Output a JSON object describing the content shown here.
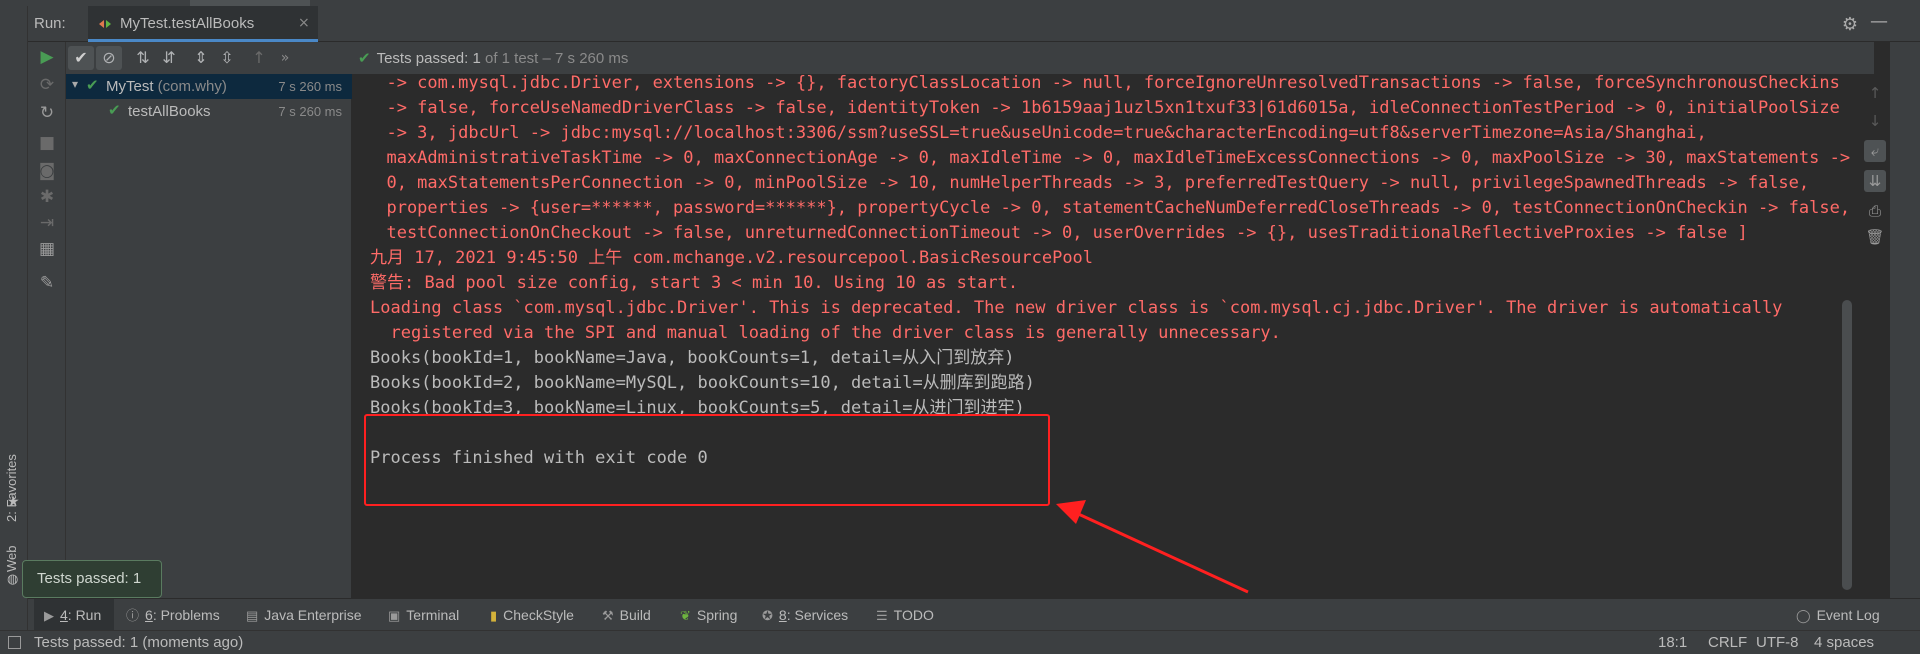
{
  "editor_tab_fragment": "MyTest",
  "run_header": {
    "label": "Run:",
    "tab_title": "MyTest.testAllBooks",
    "tab_close": "×"
  },
  "test_toolbar": {
    "status_prefix": "Tests passed: ",
    "status_count": "1",
    "status_suffix": " of 1 test – 7 s 260 ms",
    "more": "»"
  },
  "test_tree": [
    {
      "name": "MyTest",
      "pkg": " (com.why)",
      "time": "7 s 260 ms"
    },
    {
      "name": "testAllBooks",
      "pkg": "",
      "time": "7 s 260 ms"
    }
  ],
  "console": {
    "lines": [
      {
        "text": "  -> com.mysql.jdbc.Driver, extensions -> {}, factoryClassLocation -> null, forceIgnoreUnresolvedTransactions -> false, forceSynchronousCheckins",
        "style": "red"
      },
      {
        "text": "  -> false, forceUseNamedDriverClass -> false, identityToken -> 1b6159aaj1uzl5xn1txuf33|61d6015a, idleConnectionTestPeriod -> 0, initialPoolSize",
        "style": "red"
      },
      {
        "text": "  -> 3, jdbcUrl -> jdbc:mysql://localhost:3306/ssm?useSSL=true&useUnicode=true&characterEncoding=utf8&serverTimezone=Asia/Shanghai,",
        "style": "red"
      },
      {
        "text": "  maxAdministrativeTaskTime -> 0, maxConnectionAge -> 0, maxIdleTime -> 0, maxIdleTimeExcessConnections -> 0, maxPoolSize -> 30, maxStatements ->",
        "style": "red"
      },
      {
        "text": "  0, maxStatementsPerConnection -> 0, minPoolSize -> 10, numHelperThreads -> 3, preferredTestQuery -> null, privilegeSpawnedThreads -> false,",
        "style": "red"
      },
      {
        "text": "  properties -> {user=******, password=******}, propertyCycle -> 0, statementCacheNumDeferredCloseThreads -> 0, testConnectionOnCheckin -> false,",
        "style": "red"
      },
      {
        "text": "  testConnectionOnCheckout -> false, unreturnedConnectionTimeout -> 0, userOverrides -> {}, usesTraditionalReflectiveProxies -> false ]",
        "style": "red"
      },
      {
        "text": "九月 17, 2021 9:45:50 上午 com.mchange.v2.resourcepool.BasicResourcePool",
        "style": "red"
      },
      {
        "text": "警告: Bad pool size config, start 3 < min 10. Using 10 as start.",
        "style": "red"
      },
      {
        "text": "Loading class `com.mysql.jdbc.Driver'. This is deprecated. The new driver class is `com.mysql.cj.jdbc.Driver'. The driver is automatically",
        "style": "red"
      },
      {
        "text": "  registered via the SPI and manual loading of the driver class is generally unnecessary.",
        "style": "red"
      },
      {
        "text": "Books(bookId=1, bookName=Java, bookCounts=1, detail=从入门到放弃)",
        "style": "norm"
      },
      {
        "text": "Books(bookId=2, bookName=MySQL, bookCounts=10, detail=从删库到跑路)",
        "style": "norm"
      },
      {
        "text": "Books(bookId=3, bookName=Linux, bookCounts=5, detail=从进门到进牢)",
        "style": "norm"
      },
      {
        "text": "",
        "style": "norm"
      },
      {
        "text": "Process finished with exit code 0",
        "style": "norm"
      }
    ]
  },
  "side_labels": {
    "favorites": "2: Favorites",
    "web": "Web"
  },
  "tooltip": "Tests passed: 1",
  "bottom_bar": {
    "run": {
      "num": "4",
      "label": ": Run"
    },
    "problems": {
      "num": "6",
      "label": ": Problems"
    },
    "java_enterprise": "Java Enterprise",
    "terminal": "Terminal",
    "checkstyle": "CheckStyle",
    "build": "Build",
    "spring": "Spring",
    "services": {
      "num": "8",
      "label": ": Services"
    },
    "todo": "TODO",
    "event_log": "Event Log"
  },
  "status_bar": {
    "message": "Tests passed: 1 (moments ago)",
    "position": "18:1",
    "line_sep": "CRLF",
    "encoding": "UTF-8",
    "indent": "4 spaces"
  },
  "colors": {
    "error_text": "#ff6b68",
    "pass_green": "#499c54",
    "highlight_red": "#ff2020"
  }
}
